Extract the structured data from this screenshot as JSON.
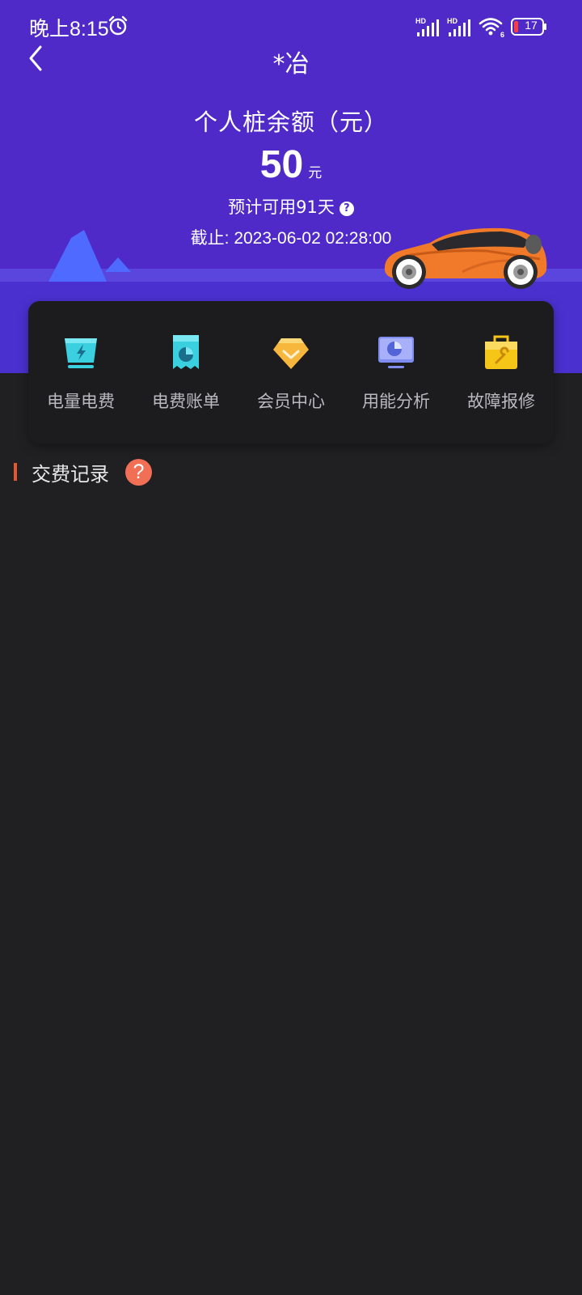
{
  "status_bar": {
    "time": "晚上8:15",
    "signal_1_label": "HD",
    "signal_2_label": "HD",
    "wifi_label": "6",
    "battery_level": "17",
    "icons": [
      "alarm-icon",
      "signal-icon",
      "signal-icon",
      "wifi-icon",
      "battery-icon"
    ]
  },
  "header": {
    "back_icon": "chevron-left-icon",
    "title": "*冶",
    "balance_label": "个人桩余额（元）",
    "balance_value": "50",
    "balance_unit": "元",
    "days_text": "预计可用91天",
    "days_help": "?",
    "deadline": "截止: 2023-06-02 02:28:00"
  },
  "menu": {
    "items": [
      {
        "label": "电量电费",
        "icon": "battery-charge-icon",
        "color": "#3ad0e0"
      },
      {
        "label": "电费账单",
        "icon": "bill-icon",
        "color": "#3ad0e0"
      },
      {
        "label": "会员中心",
        "icon": "diamond-icon",
        "color": "#f6b73c"
      },
      {
        "label": "用能分析",
        "icon": "monitor-chart-icon",
        "color": "#7f8cf0"
      },
      {
        "label": "故障报修",
        "icon": "toolbox-icon",
        "color": "#f5c518"
      }
    ]
  },
  "records": {
    "title": "交费记录",
    "help": "?"
  },
  "colors": {
    "header_bg": "#4f2ac9",
    "page_bg": "#202022",
    "card_bg": "#1c1c1e",
    "accent": "#e0582b"
  }
}
